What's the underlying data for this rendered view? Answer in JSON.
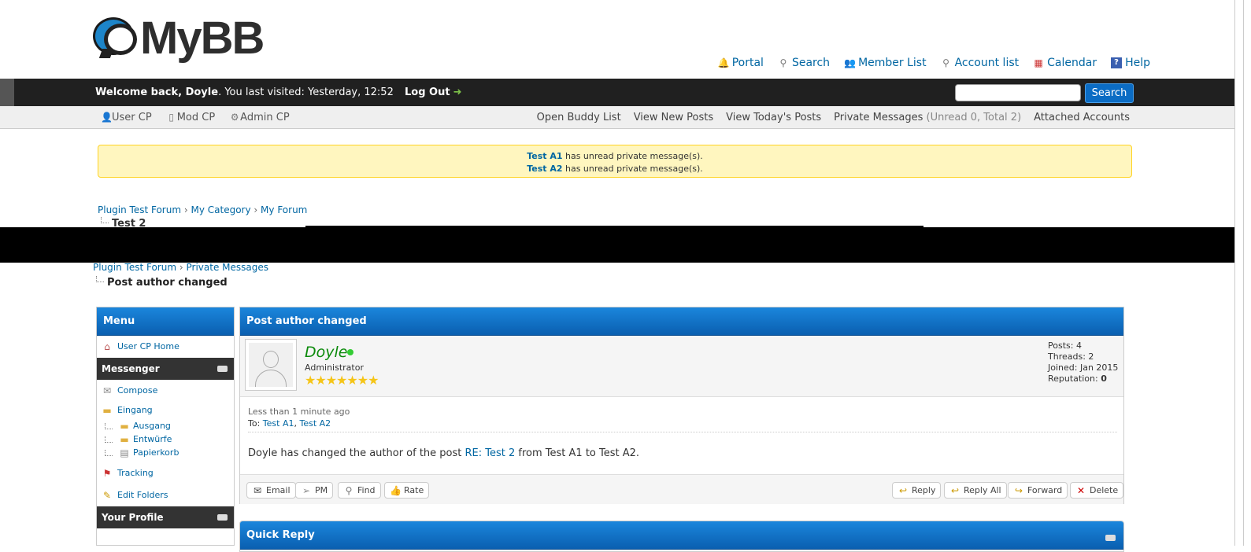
{
  "header": {
    "logo_text": "MyBB",
    "toplinks": [
      {
        "label": "Portal",
        "icon": "bell-icon"
      },
      {
        "label": "Search",
        "icon": "magnifier-icon"
      },
      {
        "label": "Member List",
        "icon": "users-icon"
      },
      {
        "label": "Account list",
        "icon": "magnifier-icon"
      },
      {
        "label": "Calendar",
        "icon": "calendar-icon"
      },
      {
        "label": "Help",
        "icon": "help-icon"
      }
    ]
  },
  "welcome": {
    "greeting": "Welcome back, ",
    "username": "Doyle",
    "visited": ". You last visited: Yesterday, 12:52",
    "logout": "Log Out",
    "search_button": "Search"
  },
  "panel": {
    "left": [
      "User CP",
      "Mod CP",
      "Admin CP"
    ],
    "right": {
      "buddy": "Open Buddy List",
      "new_posts": "View New Posts",
      "today_posts": "View Today's Posts",
      "pm": "Private Messages",
      "pm_counts": "(Unread 0, Total 2)",
      "attached": "Attached Accounts"
    }
  },
  "pm_notice": [
    {
      "user": "Test A1",
      "text": " has unread private message(s)."
    },
    {
      "user": "Test A2",
      "text": " has unread private message(s)."
    }
  ],
  "breadcrumb1": {
    "items": [
      "Plugin Test Forum",
      "My Category",
      "My Forum"
    ],
    "current": "Test 2"
  },
  "breadcrumb2": {
    "items": [
      "Plugin Test Forum",
      "Private Messages"
    ],
    "current": "Post author changed"
  },
  "menu": {
    "title": "Menu",
    "usercp_home": "User CP Home",
    "messenger": "Messenger",
    "compose": "Compose",
    "inbox": "Eingang",
    "folders": [
      "Ausgang",
      "Entwürfe",
      "Papierkorb"
    ],
    "tracking": "Tracking",
    "edit_folders": "Edit Folders",
    "your_profile": "Your Profile"
  },
  "post": {
    "title": "Post author changed",
    "author": "Doyle",
    "usertitle": "Administrator",
    "stars": "★★★★★★★",
    "stats": {
      "posts": "Posts: 4",
      "threads": "Threads: 2",
      "joined": "Joined: Jan 2015",
      "reputation_label": "Reputation: ",
      "reputation": "0"
    },
    "date": "Less than 1 minute ago",
    "to_label": "To: ",
    "to_users": [
      "Test A1",
      "Test A2"
    ],
    "body_pre": "Doyle has changed the author of the post ",
    "body_link": "RE: Test 2",
    "body_post": " from Test A1 to Test A2.",
    "buttons_left": [
      "Email",
      "PM",
      "Find",
      "Rate"
    ],
    "buttons_right": [
      "Reply",
      "Reply All",
      "Forward",
      "Delete"
    ]
  },
  "quick_reply": {
    "title": "Quick Reply"
  }
}
